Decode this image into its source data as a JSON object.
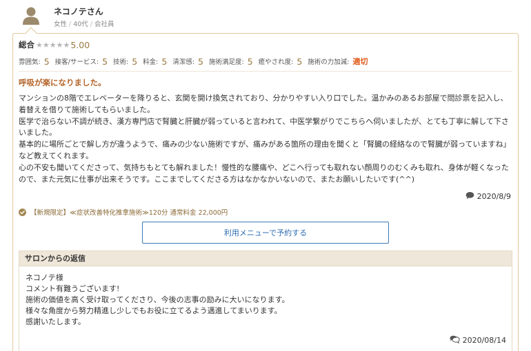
{
  "reviewer": {
    "name": "ネコノテさん",
    "gender": "女性",
    "age": "40代",
    "occupation": "会社員"
  },
  "overall": {
    "label": "総合",
    "score": "5.00",
    "stars": 5,
    "star_color": "#b5b5b5"
  },
  "ratings": [
    {
      "label": "雰囲気:",
      "value": "5"
    },
    {
      "label": "接客/サービス:",
      "value": "5"
    },
    {
      "label": "技術:",
      "value": "5"
    },
    {
      "label": "料金:",
      "value": "5"
    },
    {
      "label": "清潔感:",
      "value": "5"
    },
    {
      "label": "施術満足度:",
      "value": "5"
    },
    {
      "label": "癒やされ度:",
      "value": "5"
    },
    {
      "label": "施術の力加減:",
      "value": "適切"
    }
  ],
  "review": {
    "title": "呼吸が楽になりました。",
    "paragraphs": [
      "マンションの8階でエレベーターを降りると、玄関を開け換気されており、分かりやすい入り口でした。温かみのあるお部屋で問診票を記入し、着替えを借りて施術してもらいました。",
      "医学で治らない不調が続き、漢方専門店で腎臓と肝臓が弱っていると言われて、中医学繋がりでこちらへ伺いましたが、とても丁寧に解して下さいました。",
      "基本的に場所ごとで解し方が違うようで、痛みの少ない施術ですが、痛みがある箇所の理由を聞くと「腎臓の経絡なので腎臓が弱っていますね」など教えてくれます。",
      "心の不安も聞いてくださって、気持ちもとても解れました！慢性的な腰痛や、どこへ行っても取れない顔周りのむくみも取れ、身体が軽くなったので、また元気に仕事が出来そうです。ここまでしてくださる方はなかなかいないので、またお願いしたいです(^^)"
    ],
    "date": "2020/8/9"
  },
  "menu": {
    "text": "【新規限定】≪症状改善特化推拿施術≫120分 通常料金 22,000円"
  },
  "reserve_button": {
    "label": "利用メニューで予約する"
  },
  "reply": {
    "header": "サロンからの返信",
    "lines": [
      "ネコノテ様",
      "コメント有難うございます!",
      "施術の価値を高く受け取ってくださり、今後の志事の励みに大いになります。",
      "様々な角度から努力精進し少しでもお役に立てるよう邁進してまいります。",
      "感謝いたします。"
    ],
    "date": "2020/08/14"
  },
  "colors": {
    "accent_brown": "#9b7a3f",
    "title_orange": "#b4652a",
    "highlight_orange": "#e05a1a",
    "button_blue": "#2f6fb3",
    "card_border": "#e2c79a",
    "reply_header_bg": "#efe7d9"
  }
}
